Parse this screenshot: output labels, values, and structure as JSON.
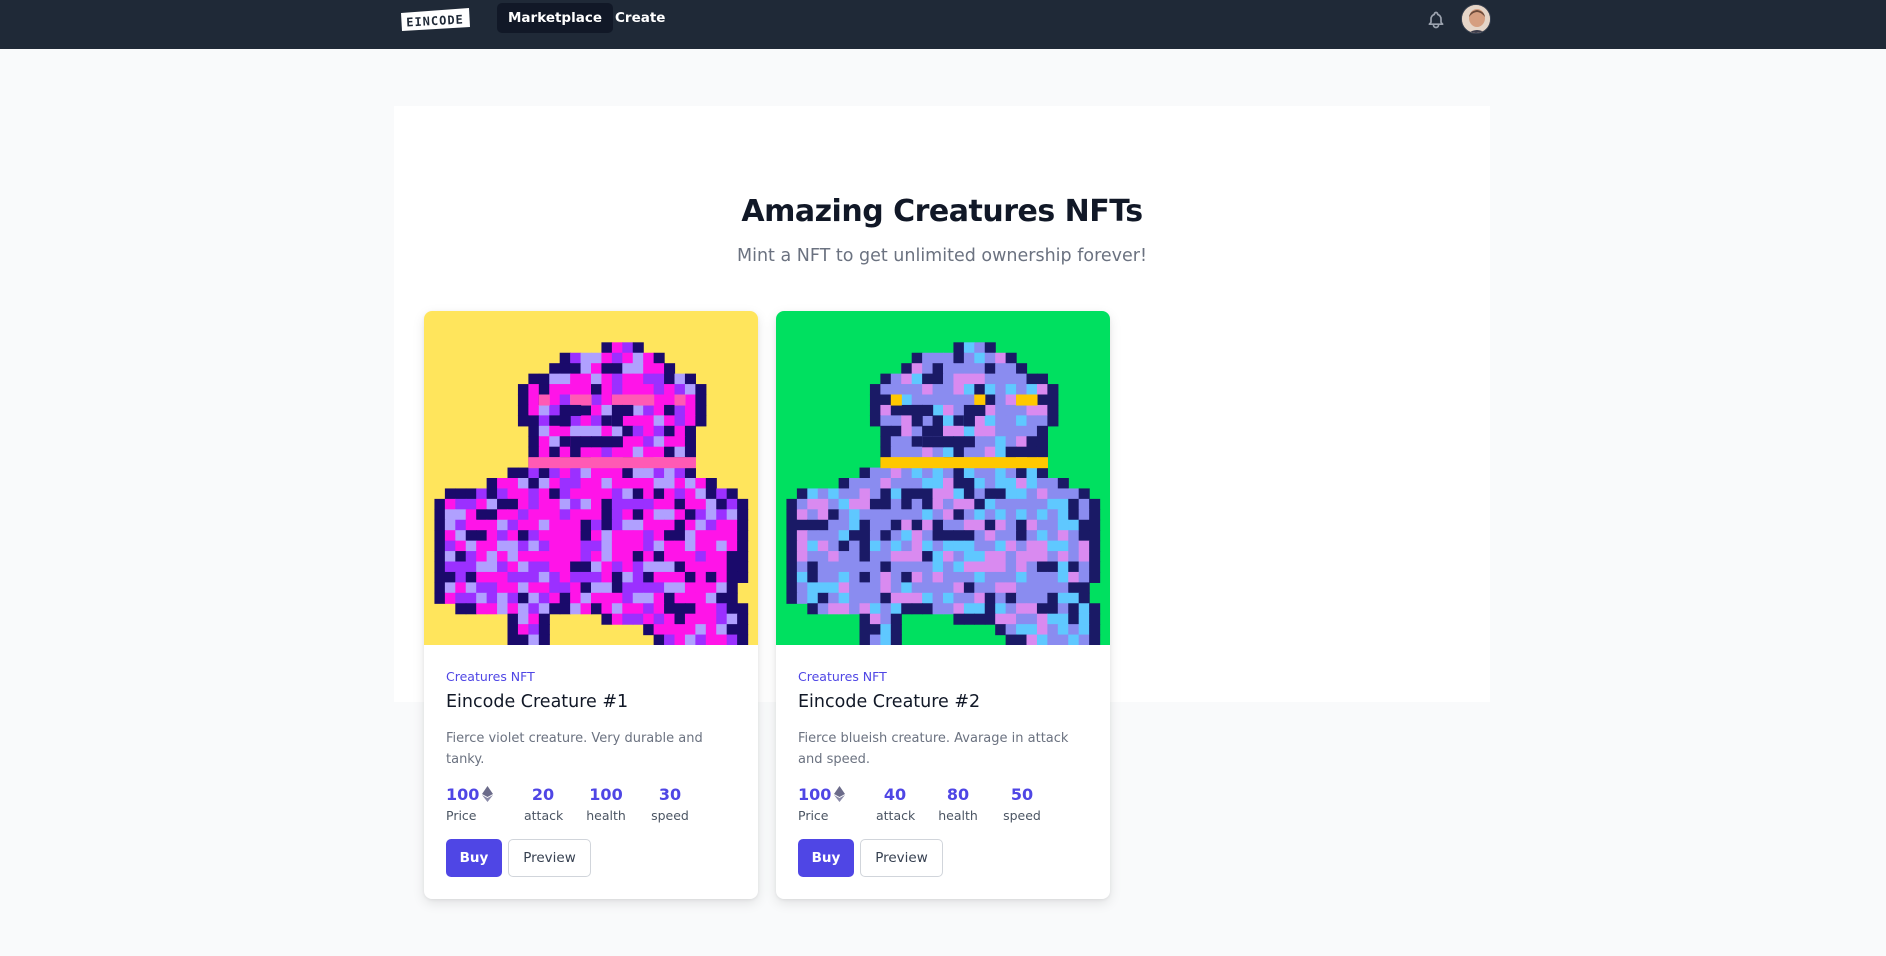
{
  "nav": {
    "logo_text": "EINCODE",
    "items": [
      {
        "label": "Marketplace",
        "active": true
      },
      {
        "label": "Create",
        "active": false
      }
    ],
    "icons": [
      "bell-icon",
      "avatar"
    ]
  },
  "hero": {
    "title": "Amazing Creatures NFTs",
    "subtitle": "Mint a NFT to get unlimited ownership forever!"
  },
  "cards": [
    {
      "collection": "Creatures NFT",
      "title": "Eincode Creature #1",
      "description": "Fierce violet creature. Very durable and tanky.",
      "background": "#ffe55c",
      "stats": [
        {
          "value": "100",
          "label": "Price"
        },
        {
          "value": "20",
          "label": "attack"
        },
        {
          "value": "100",
          "label": "health"
        },
        {
          "value": "30",
          "label": "speed"
        }
      ],
      "buy_label": "Buy",
      "preview_label": "Preview"
    },
    {
      "collection": "Creatures NFT",
      "title": "Eincode Creature #2",
      "description": "Fierce blueish creature. Avarage in attack and speed.",
      "background": "#00e060",
      "stats": [
        {
          "value": "100",
          "label": "Price"
        },
        {
          "value": "40",
          "label": "attack"
        },
        {
          "value": "80",
          "label": "health"
        },
        {
          "value": "50",
          "label": "speed"
        }
      ],
      "buy_label": "Buy",
      "preview_label": "Preview"
    }
  ],
  "colors": {
    "navbar": "#1f2937",
    "accent": "#4f46e5",
    "page_bg": "#f9fafb"
  }
}
